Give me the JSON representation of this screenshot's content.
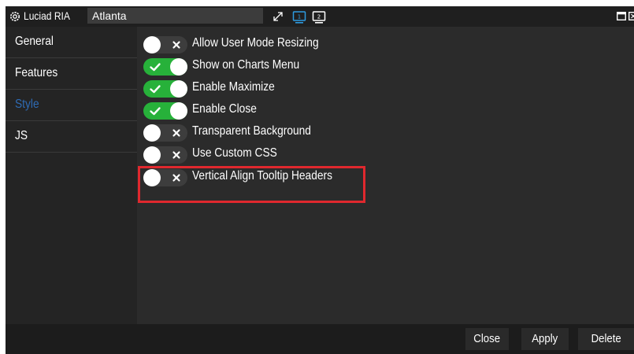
{
  "titlebar": {
    "app_name": "Luciad RIA",
    "window_name": "Atlanta",
    "screen1_label": "1",
    "screen2_label": "2"
  },
  "sidebar": {
    "items": [
      {
        "label": "General",
        "active": false
      },
      {
        "label": "Features",
        "active": false
      },
      {
        "label": "Style",
        "active": true
      },
      {
        "label": "JS",
        "active": false
      }
    ]
  },
  "options": [
    {
      "label": "Allow User Mode Resizing",
      "enabled": false
    },
    {
      "label": "Show on Charts Menu",
      "enabled": true
    },
    {
      "label": "Enable Maximize",
      "enabled": true
    },
    {
      "label": "Enable Close",
      "enabled": true
    },
    {
      "label": "Transparent Background",
      "enabled": false
    },
    {
      "label": "Use Custom CSS",
      "enabled": false
    },
    {
      "label": "Vertical Align Tooltip Headers",
      "enabled": false
    }
  ],
  "footer": {
    "close_label": "Close",
    "apply_label": "Apply",
    "delete_label": "Delete"
  },
  "colors": {
    "accent": "#2e6bb5",
    "toggle_on": "#27b13a",
    "highlight": "#e0282e"
  }
}
